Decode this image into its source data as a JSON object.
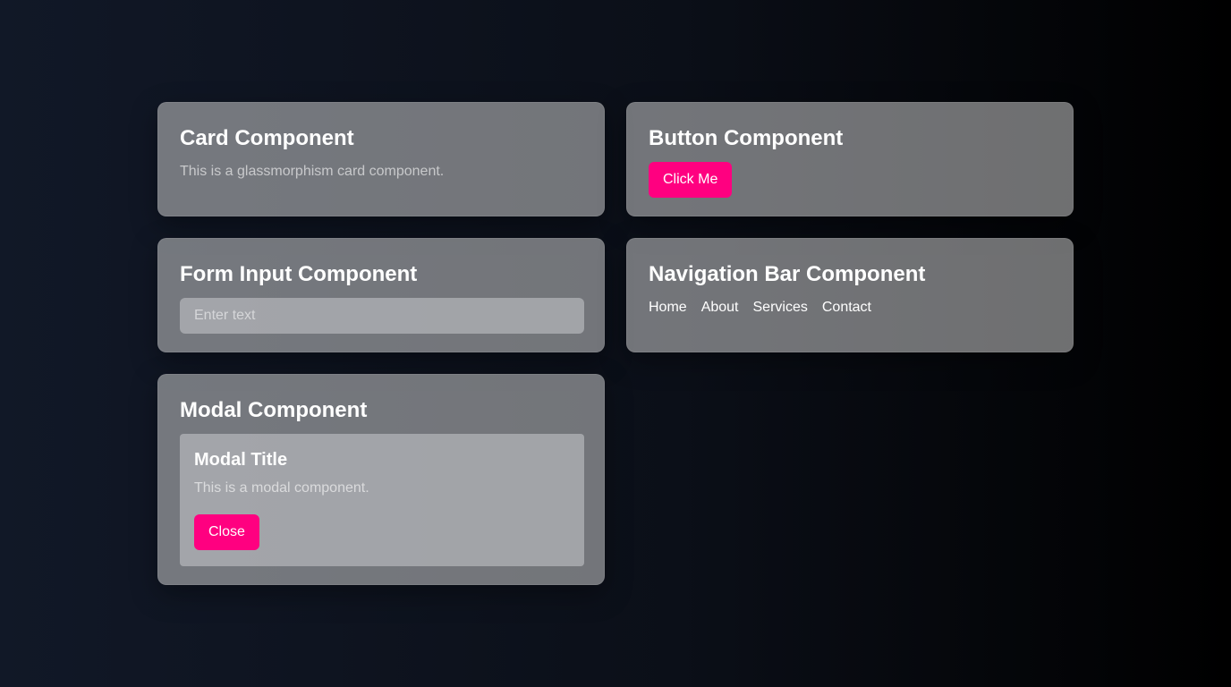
{
  "card": {
    "title": "Card Component",
    "text": "This is a glassmorphism card component."
  },
  "button_card": {
    "title": "Button Component",
    "button_label": "Click Me"
  },
  "form_card": {
    "title": "Form Input Component",
    "input_value": "",
    "input_placeholder": "Enter text"
  },
  "nav_card": {
    "title": "Navigation Bar Component",
    "links": [
      {
        "label": "Home"
      },
      {
        "label": "About"
      },
      {
        "label": "Services"
      },
      {
        "label": "Contact"
      }
    ]
  },
  "modal_card": {
    "title": "Modal Component",
    "modal": {
      "title": "Modal Title",
      "text": "This is a modal component.",
      "close_label": "Close"
    }
  },
  "colors": {
    "accent": "#ff0080",
    "background_start": "#111827",
    "background_end": "#000000"
  }
}
